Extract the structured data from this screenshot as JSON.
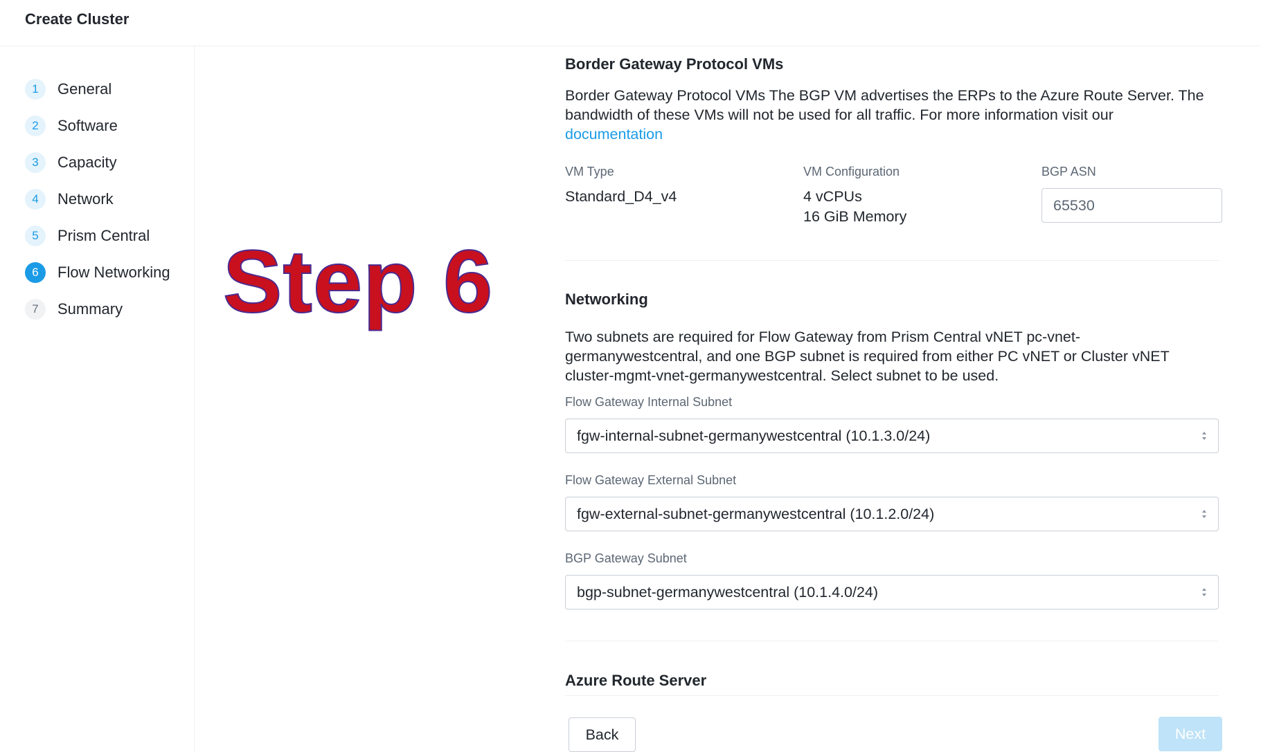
{
  "header": {
    "title": "Create Cluster"
  },
  "sidebar": {
    "steps": [
      {
        "number": "1",
        "label": "General"
      },
      {
        "number": "2",
        "label": "Software"
      },
      {
        "number": "3",
        "label": "Capacity"
      },
      {
        "number": "4",
        "label": "Network"
      },
      {
        "number": "5",
        "label": "Prism Central"
      },
      {
        "number": "6",
        "label": "Flow Networking"
      },
      {
        "number": "7",
        "label": "Summary"
      }
    ],
    "active_step": "6"
  },
  "overlay": {
    "text": "Step 6"
  },
  "bgp_section": {
    "title": "Border Gateway Protocol VMs",
    "description_1": "Border Gateway Protocol VMs The BGP VM advertises the ERPs to the Azure Route Server. The",
    "description_2": "bandwidth of these VMs will not be used for all traffic. For more information visit our",
    "link_text": "documentation",
    "vm_type_label": "VM Type",
    "vm_type_value": "Standard_D4_v4",
    "vm_config_label": "VM Configuration",
    "vm_config_cpus": "4 vCPUs",
    "vm_config_memory": "16 GiB Memory",
    "bgp_asn_label": "BGP ASN",
    "bgp_asn_value": "65530"
  },
  "networking_section": {
    "title": "Networking",
    "description_1": "Two subnets are required for Flow Gateway from Prism Central vNET pc-vnet-",
    "description_2": "germanywestcentral, and one BGP subnet is required from either PC vNET or Cluster vNET",
    "description_3": "cluster-mgmt-vnet-germanywestcentral. Select subnet to be used.",
    "internal_label": "Flow Gateway Internal Subnet",
    "internal_value": "fgw-internal-subnet-germanywestcentral (10.1.3.0/24)",
    "external_label": "Flow Gateway External Subnet",
    "external_value": "fgw-external-subnet-germanywestcentral (10.1.2.0/24)",
    "bgp_label": "BGP Gateway Subnet",
    "bgp_value": "bgp-subnet-germanywestcentral (10.1.4.0/24)"
  },
  "azure_section": {
    "title": "Azure Route Server"
  },
  "footer": {
    "back_label": "Back",
    "next_label": "Next"
  },
  "colors": {
    "accent": "#1b9be6",
    "next_disabled": "#bfe3f8",
    "overlay_red": "#c8101e"
  }
}
